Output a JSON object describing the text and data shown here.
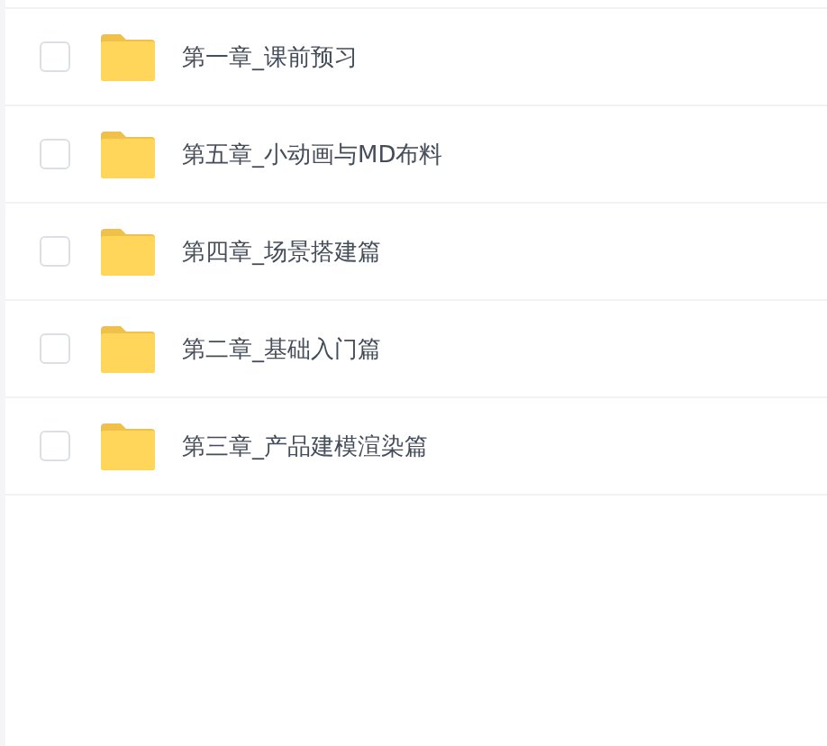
{
  "files": [
    {
      "name": "第一章_课前预习",
      "checked": false
    },
    {
      "name": "第五章_小动画与MD布料",
      "checked": false
    },
    {
      "name": "第四章_场景搭建篇",
      "checked": false
    },
    {
      "name": "第二章_基础入门篇",
      "checked": false
    },
    {
      "name": "第三章_产品建模渲染篇",
      "checked": false
    }
  ]
}
